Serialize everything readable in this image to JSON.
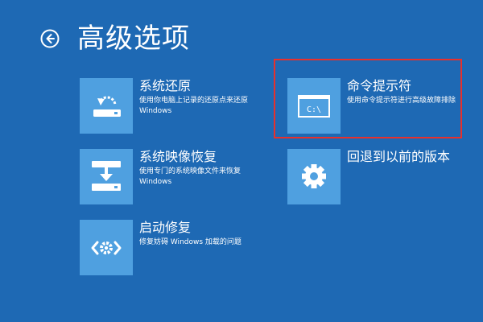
{
  "page": {
    "title": "高级选项"
  },
  "options": {
    "system_restore": {
      "title": "系统还原",
      "description": "使用你电脑上记录的还原点来还原 Windows",
      "icon": "restore-icon"
    },
    "image_recovery": {
      "title": "系统映像恢复",
      "description": "使用专门的系统映像文件来恢复 Windows",
      "icon": "image-recovery-icon"
    },
    "startup_repair": {
      "title": "启动修复",
      "description": "修复妨碍 Windows 加载的问题",
      "icon": "startup-repair-icon"
    },
    "command_prompt": {
      "title": "命令提示符",
      "description": "使用命令提示符进行高级故障排除",
      "icon": "command-prompt-icon",
      "icon_text": "C:\\"
    },
    "go_back": {
      "title": "回退到以前的版本",
      "icon": "gear-icon"
    }
  },
  "colors": {
    "background": "#1e69b4",
    "tile": "#4fa0e0",
    "highlight": "#e8302c",
    "text": "#ffffff"
  }
}
